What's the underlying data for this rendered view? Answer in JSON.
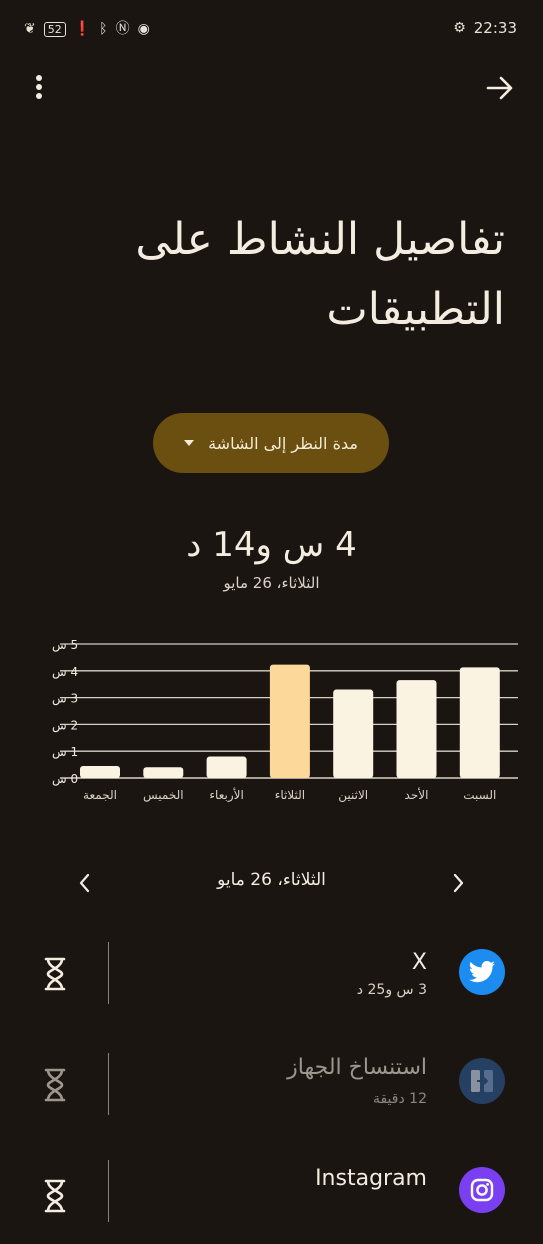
{
  "status_bar": {
    "battery": "52",
    "time": "22:33"
  },
  "header": {
    "title": "تفاصيل النشاط على التطبيقات"
  },
  "dropdown": {
    "label": "مدة النظر إلى الشاشة"
  },
  "summary": {
    "total": "4 س و14 د",
    "date": "الثلاثاء، 26 مايو"
  },
  "chart_data": {
    "type": "bar",
    "categories": [
      "الجمعة",
      "الخميس",
      "الأربعاء",
      "الثلاثاء",
      "الاثنين",
      "الأحد",
      "السبت"
    ],
    "values": [
      0.45,
      0.4,
      0.8,
      4.23,
      3.3,
      3.65,
      4.13
    ],
    "highlight_index": 3,
    "ylim": [
      0,
      5
    ],
    "yticks": [
      "0 س",
      "1 س",
      "2 س",
      "3 س",
      "4 س",
      "5 س"
    ],
    "grid": true,
    "colors": {
      "bar": "#fbf3e2",
      "highlight": "#fcd99a",
      "grid": "#d8d2c6"
    }
  },
  "date_nav": {
    "label": "الثلاثاء، 26 مايو"
  },
  "apps": [
    {
      "name": "X",
      "time": "3 س و25 د",
      "icon": "twitter-bird-icon",
      "color": "#1d8cf0"
    },
    {
      "name": "استنساخ الجهاز",
      "time": "12 دقيقة",
      "icon": "device-clone-icon",
      "color": "#2e5d9c"
    },
    {
      "name": "Instagram",
      "time": "",
      "icon": "instagram-icon",
      "color": "#7b3ff2"
    }
  ]
}
